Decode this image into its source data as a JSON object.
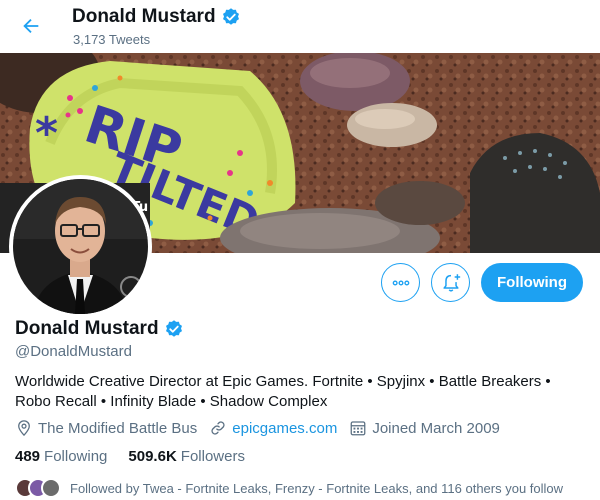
{
  "header": {
    "name": "Donald Mustard",
    "tweet_count": "3,173 Tweets",
    "back_icon": "arrow-left-icon",
    "verified_icon": "verified-badge-icon"
  },
  "banner": {
    "rock_text_line1": "RIP",
    "rock_text_line2": "TILTED",
    "backdrop_text": "YouTu"
  },
  "actions": {
    "more_icon": "more-options-icon",
    "notify_icon": "bell-plus-icon",
    "follow_label": "Following"
  },
  "profile": {
    "name": "Donald Mustard",
    "handle": "@DonaldMustard",
    "bio": "Worldwide Creative Director at Epic Games. Fortnite • Spyjinx • Battle Breakers • Robo Recall • Infinity Blade • Shadow Complex",
    "location": "The Modified Battle Bus",
    "website": "epicgames.com",
    "joined": "Joined March 2009",
    "location_icon": "location-pin-icon",
    "link_icon": "link-icon",
    "calendar_icon": "calendar-icon"
  },
  "stats": {
    "following_count": "489",
    "following_label": "Following",
    "followers_count": "509.6K",
    "followers_label": "Followers"
  },
  "followed_by": {
    "text": "Followed by Twea - Fortnite Leaks, Frenzy - Fortnite Leaks, and 116 others you follow"
  },
  "colors": {
    "accent": "#1da1f2",
    "secondary_text": "#5b7083",
    "link": "#1b95e0"
  }
}
